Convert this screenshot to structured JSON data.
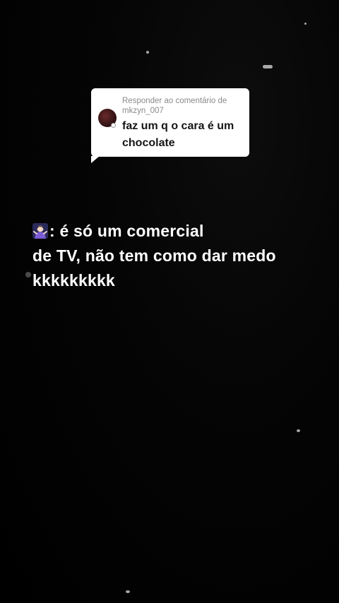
{
  "reply_card": {
    "caption": "Responder ao comentário de",
    "username": "mkzyn_007",
    "comment": "faz um q o cara é um chocolate"
  },
  "overlay": {
    "emoji": "person-shrugging-emoji",
    "line1": ": é só um comercial",
    "line2": "de TV, não tem como dar medo",
    "line3": "kkkkkkkkk"
  },
  "colors": {
    "background": "#000000",
    "card": "#ffffff",
    "caption_gray": "#8a8a8a",
    "overlay_text": "#ffffff"
  }
}
